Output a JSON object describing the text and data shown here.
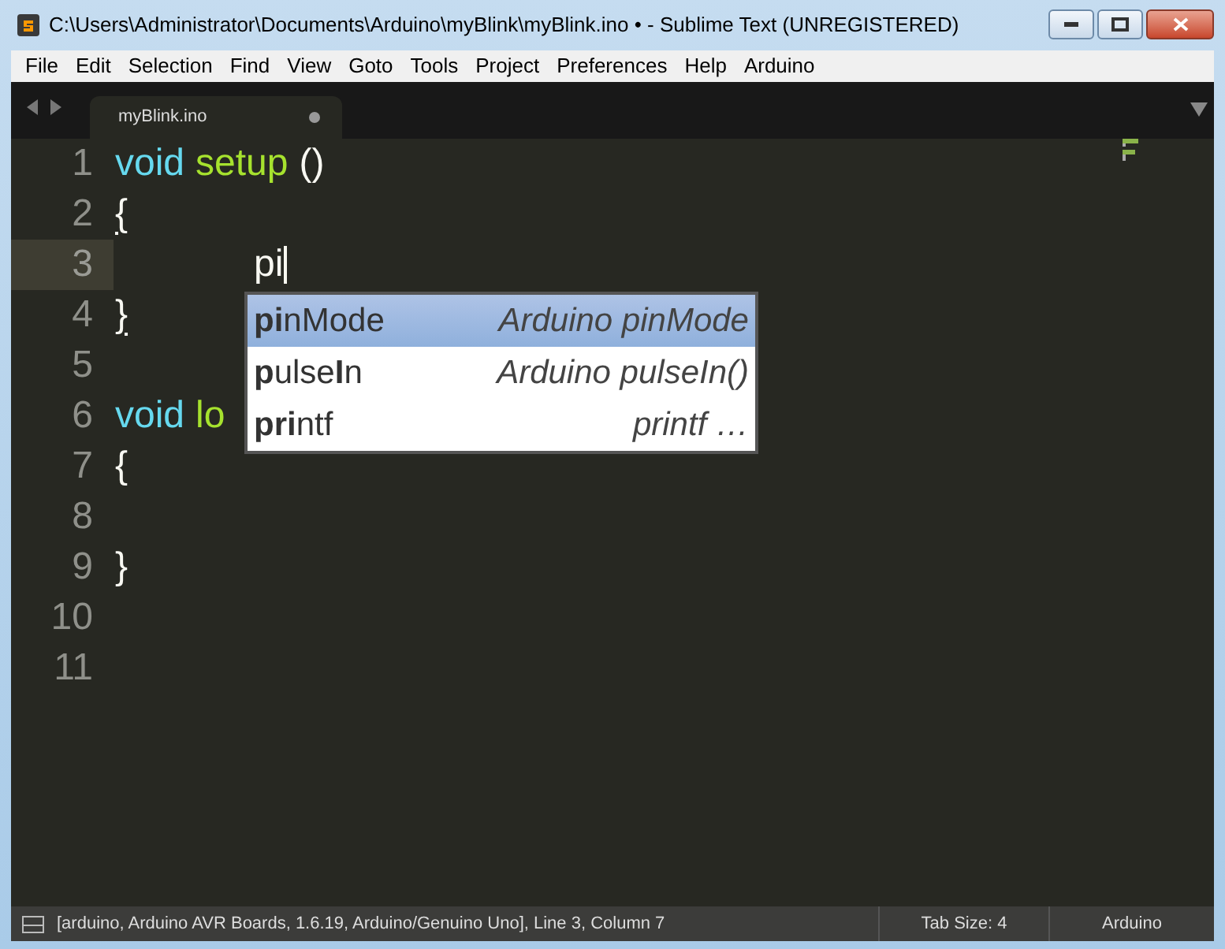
{
  "window": {
    "title": "C:\\Users\\Administrator\\Documents\\Arduino\\myBlink\\myBlink.ino • - Sublime Text (UNREGISTERED)"
  },
  "menu": [
    "File",
    "Edit",
    "Selection",
    "Find",
    "View",
    "Goto",
    "Tools",
    "Project",
    "Preferences",
    "Help",
    "Arduino"
  ],
  "tabs": [
    {
      "label": "myBlink.ino",
      "selected": true,
      "modified": true
    }
  ],
  "editor": {
    "lines": [
      {
        "number": "1",
        "current": false,
        "tokens": [
          {
            "kind": "keyword",
            "text": "void"
          },
          {
            "kind": "function",
            "text": "setup"
          },
          {
            "kind": "plain",
            "text": "()"
          }
        ]
      },
      {
        "number": "2",
        "current": false,
        "tokens": [
          {
            "kind": "bracket",
            "text": "{"
          }
        ]
      },
      {
        "number": "3",
        "current": true,
        "indented": true,
        "tokens": [
          {
            "kind": "plain",
            "text": "pi"
          }
        ]
      },
      {
        "number": "4",
        "current": false,
        "tokens": [
          {
            "kind": "bracket",
            "text": "}"
          }
        ]
      },
      {
        "number": "5",
        "current": false
      },
      {
        "number": "6",
        "current": false,
        "tokens": [
          {
            "kind": "keyword",
            "text": "void"
          },
          {
            "kind": "function",
            "text": "lo"
          }
        ]
      },
      {
        "number": "7",
        "current": false,
        "tokens": [
          {
            "kind": "plain",
            "text": "{"
          }
        ]
      },
      {
        "number": "8",
        "current": false
      },
      {
        "number": "9",
        "current": false,
        "tokens": [
          {
            "kind": "plain",
            "text": "}"
          }
        ]
      },
      {
        "number": "10",
        "current": false
      },
      {
        "number": "11",
        "current": false
      }
    ]
  },
  "autocomplete": [
    {
      "trigger": "**pi**nMode",
      "annotation": "Arduino pinMode",
      "selected": true
    },
    {
      "trigger": "**p**ulse**I**n",
      "annotation": "Arduino pulseIn()",
      "selected": false
    },
    {
      "trigger": "**pri**ntf",
      "annotation": "printf …",
      "selected": false
    }
  ],
  "status_bar": {
    "text": "[arduino, Arduino AVR Boards, 1.6.19, Arduino/Genuino Uno], Line 3, Column 7",
    "tab_size": "Tab Size: 4",
    "syntax": "Arduino"
  }
}
